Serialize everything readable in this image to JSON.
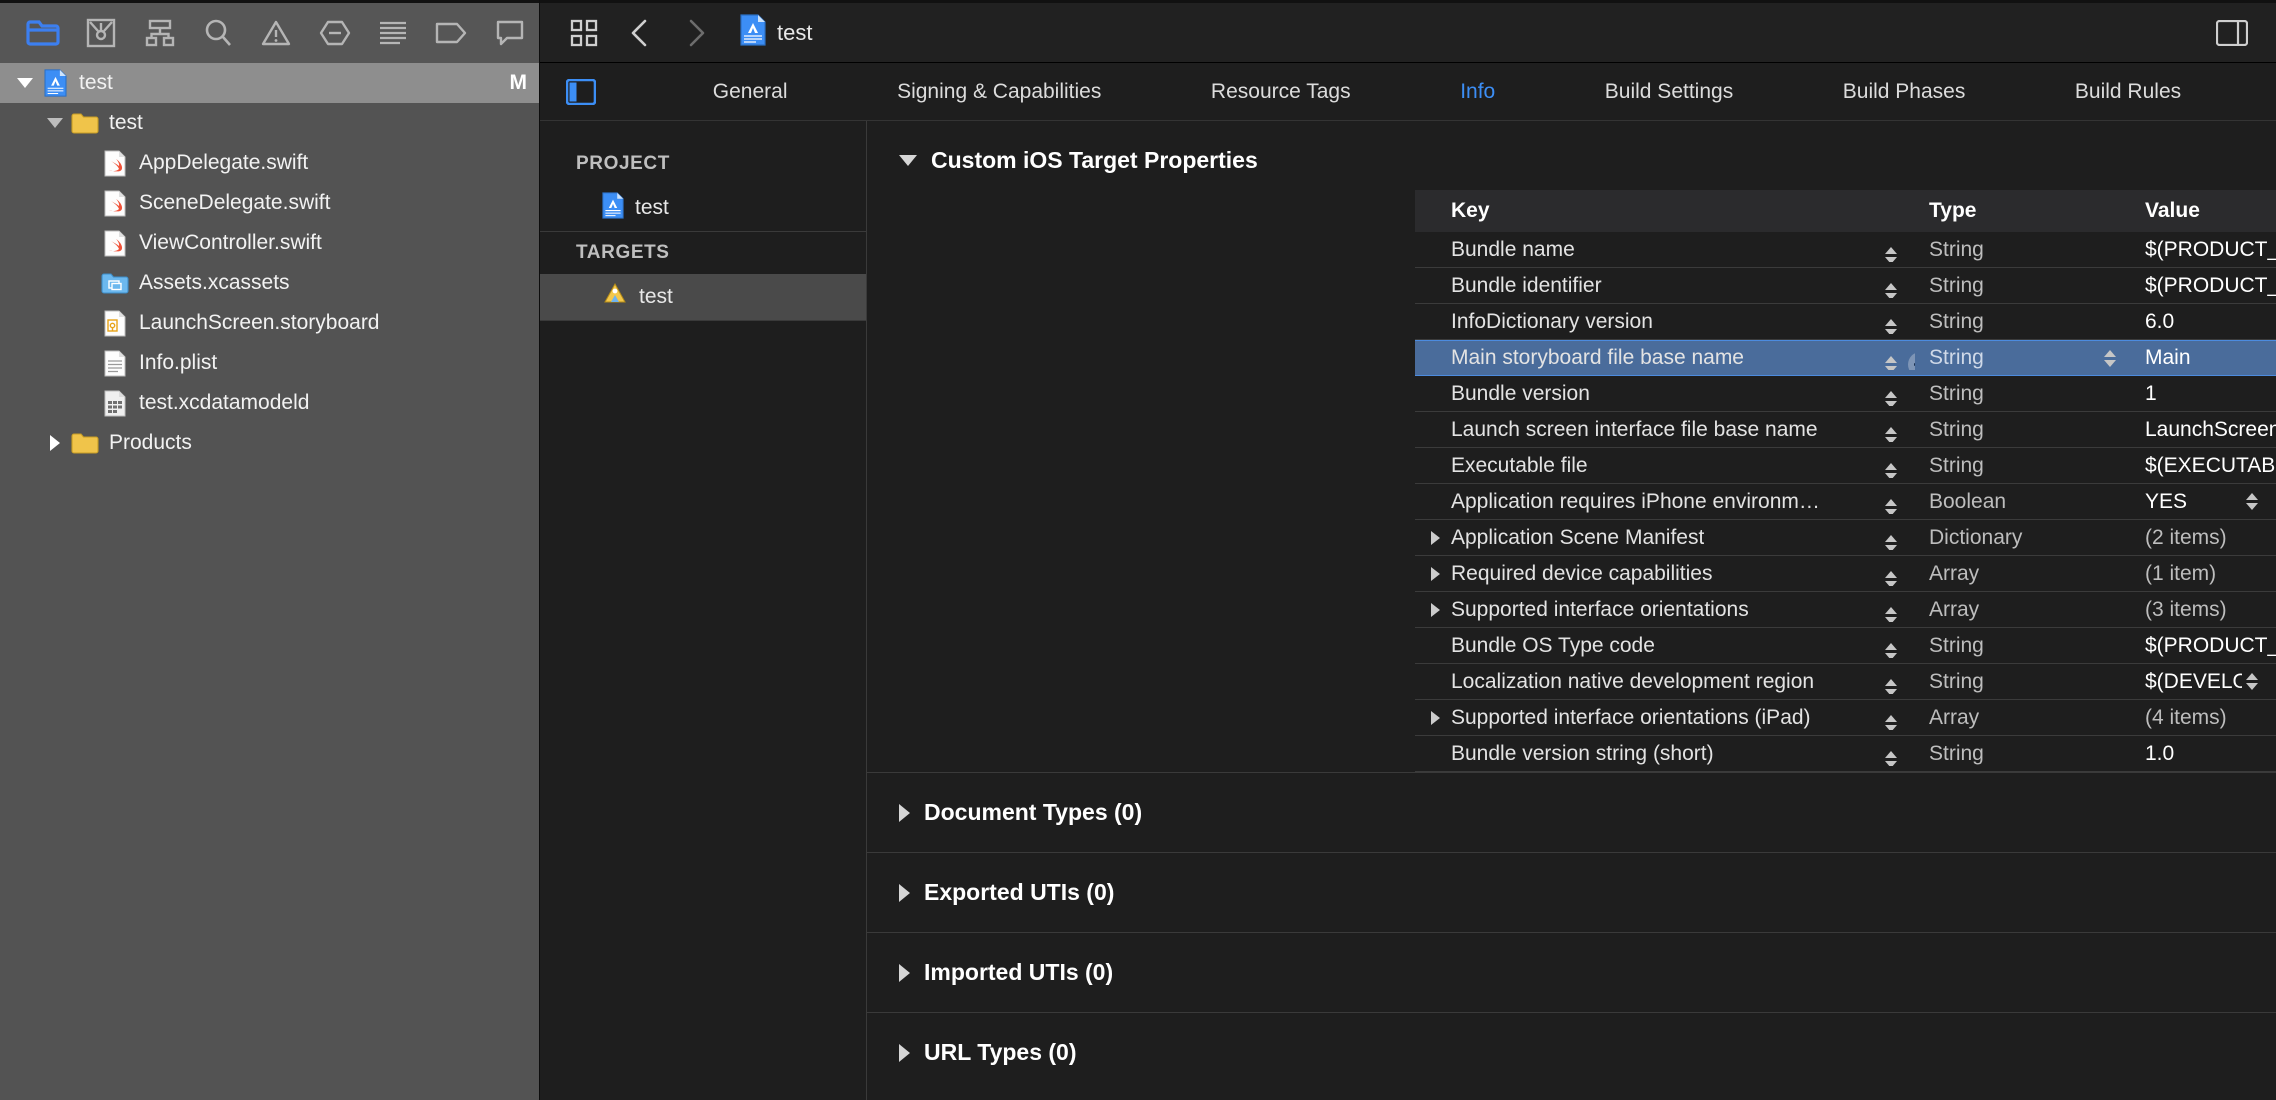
{
  "navigator": {
    "toolbar_icons": [
      {
        "name": "folder-icon",
        "active": true
      },
      {
        "name": "source-control-icon",
        "active": false
      },
      {
        "name": "symbol-hierarchy-icon",
        "active": false
      },
      {
        "name": "search-icon",
        "active": false
      },
      {
        "name": "issue-warning-icon",
        "active": false
      },
      {
        "name": "test-diamond-icon",
        "active": false
      },
      {
        "name": "debug-list-icon",
        "active": false
      },
      {
        "name": "breakpoint-tag-icon",
        "active": false
      },
      {
        "name": "report-comment-icon",
        "active": false
      }
    ],
    "tree": [
      {
        "label": "test",
        "icon": "xcode-project-icon",
        "depth": 0,
        "twisty": "down",
        "selected": true,
        "badge": "M"
      },
      {
        "label": "test",
        "icon": "folder-yellow-icon",
        "depth": 1,
        "twisty": "down",
        "selected": false,
        "badge": ""
      },
      {
        "label": "AppDelegate.swift",
        "icon": "swift-file-icon",
        "depth": 2,
        "twisty": "none",
        "selected": false,
        "badge": ""
      },
      {
        "label": "SceneDelegate.swift",
        "icon": "swift-file-icon",
        "depth": 2,
        "twisty": "none",
        "selected": false,
        "badge": ""
      },
      {
        "label": "ViewController.swift",
        "icon": "swift-file-icon",
        "depth": 2,
        "twisty": "none",
        "selected": false,
        "badge": ""
      },
      {
        "label": "Assets.xcassets",
        "icon": "assets-catalog-icon",
        "depth": 2,
        "twisty": "none",
        "selected": false,
        "badge": ""
      },
      {
        "label": "LaunchScreen.storyboard",
        "icon": "storyboard-file-icon",
        "depth": 2,
        "twisty": "none",
        "selected": false,
        "badge": ""
      },
      {
        "label": "Info.plist",
        "icon": "plist-file-icon",
        "depth": 2,
        "twisty": "none",
        "selected": false,
        "badge": ""
      },
      {
        "label": "test.xcdatamodeld",
        "icon": "datamodel-file-icon",
        "depth": 2,
        "twisty": "none",
        "selected": false,
        "badge": ""
      },
      {
        "label": "Products",
        "icon": "folder-yellow-icon",
        "depth": 1,
        "twisty": "right",
        "selected": false,
        "badge": ""
      }
    ]
  },
  "editor_toolbar": {
    "grid_icon": "editor-layout-grid-icon",
    "back_icon": "chevron-left-icon",
    "forward_icon": "chevron-right-icon",
    "breadcrumb_icon": "xcode-project-icon",
    "breadcrumb_label": "test",
    "inspector_toggle_icon": "inspector-panel-icon"
  },
  "tabbar": {
    "panel_toggle_icon": "left-panel-icon",
    "tabs": [
      {
        "label": "General",
        "active": false
      },
      {
        "label": "Signing & Capabilities",
        "active": false
      },
      {
        "label": "Resource Tags",
        "active": false
      },
      {
        "label": "Info",
        "active": true
      },
      {
        "label": "Build Settings",
        "active": false
      },
      {
        "label": "Build Phases",
        "active": false
      },
      {
        "label": "Build Rules",
        "active": false
      }
    ],
    "active_color": "#3c8ef5"
  },
  "project_sidebar": {
    "project_header": "PROJECT",
    "project_items": [
      {
        "label": "test",
        "icon": "xcode-project-icon",
        "selected": false
      }
    ],
    "targets_header": "TARGETS",
    "target_items": [
      {
        "label": "test",
        "icon": "app-target-icon",
        "selected": true
      }
    ]
  },
  "info_panel": {
    "sections": [
      {
        "title": "Custom iOS Target Properties",
        "expanded": true
      },
      {
        "title": "Document Types (0)",
        "expanded": false
      },
      {
        "title": "Exported UTIs (0)",
        "expanded": false
      },
      {
        "title": "Imported UTIs (0)",
        "expanded": false
      },
      {
        "title": "URL Types (0)",
        "expanded": false
      }
    ],
    "columns": {
      "key": "Key",
      "type": "Type",
      "value": "Value"
    },
    "rows": [
      {
        "key": "Bundle name",
        "type": "String",
        "value": "$(PRODUCT_NAME)",
        "disclosure": false,
        "selected": false,
        "value_dim": false,
        "value_stepper": false,
        "type_stepper": false
      },
      {
        "key": "Bundle identifier",
        "type": "String",
        "value": "$(PRODUCT_BUNDLE_IDENT",
        "disclosure": false,
        "selected": false,
        "value_dim": false,
        "value_stepper": false,
        "type_stepper": false
      },
      {
        "key": "InfoDictionary version",
        "type": "String",
        "value": "6.0",
        "disclosure": false,
        "selected": false,
        "value_dim": false,
        "value_stepper": false,
        "type_stepper": false
      },
      {
        "key": "Main storyboard file base name",
        "type": "String",
        "value": "Main",
        "disclosure": false,
        "selected": true,
        "value_dim": false,
        "value_stepper": false,
        "type_stepper": true
      },
      {
        "key": "Bundle version",
        "type": "String",
        "value": "1",
        "disclosure": false,
        "selected": false,
        "value_dim": false,
        "value_stepper": false,
        "type_stepper": false
      },
      {
        "key": "Launch screen interface file base name",
        "type": "String",
        "value": "LaunchScreen",
        "disclosure": false,
        "selected": false,
        "value_dim": false,
        "value_stepper": false,
        "type_stepper": false
      },
      {
        "key": "Executable file",
        "type": "String",
        "value": "$(EXECUTABLE_NAME)",
        "disclosure": false,
        "selected": false,
        "value_dim": false,
        "value_stepper": false,
        "type_stepper": false
      },
      {
        "key": "Application requires iPhone environm…",
        "type": "Boolean",
        "value": "YES",
        "disclosure": false,
        "selected": false,
        "value_dim": false,
        "value_stepper": true,
        "type_stepper": false
      },
      {
        "key": "Application Scene Manifest",
        "type": "Dictionary",
        "value": "(2 items)",
        "disclosure": true,
        "selected": false,
        "value_dim": true,
        "value_stepper": false,
        "type_stepper": false
      },
      {
        "key": "Required device capabilities",
        "type": "Array",
        "value": "(1 item)",
        "disclosure": true,
        "selected": false,
        "value_dim": true,
        "value_stepper": false,
        "type_stepper": false
      },
      {
        "key": "Supported interface orientations",
        "type": "Array",
        "value": "(3 items)",
        "disclosure": true,
        "selected": false,
        "value_dim": true,
        "value_stepper": false,
        "type_stepper": false
      },
      {
        "key": "Bundle OS Type code",
        "type": "String",
        "value": "$(PRODUCT_BUNDLE_PACK/",
        "disclosure": false,
        "selected": false,
        "value_dim": false,
        "value_stepper": false,
        "type_stepper": false
      },
      {
        "key": "Localization native development region",
        "type": "String",
        "value": "$(DEVELOPMENT_LAN…",
        "disclosure": false,
        "selected": false,
        "value_dim": false,
        "value_stepper": true,
        "type_stepper": false
      },
      {
        "key": "Supported interface orientations (iPad)",
        "type": "Array",
        "value": "(4 items)",
        "disclosure": true,
        "selected": false,
        "value_dim": true,
        "value_stepper": false,
        "type_stepper": false
      },
      {
        "key": "Bundle version string (short)",
        "type": "String",
        "value": "1.0",
        "disclosure": false,
        "selected": false,
        "value_dim": false,
        "value_stepper": false,
        "type_stepper": false
      }
    ],
    "selected_row_controls": {
      "add": "add-row-button",
      "remove": "remove-row-button"
    }
  },
  "colors": {
    "selection_blue": "#4a6c9b",
    "accent_blue": "#3c8ef5",
    "navigator_bg": "#535353",
    "editor_bg": "#1e1e1e"
  }
}
